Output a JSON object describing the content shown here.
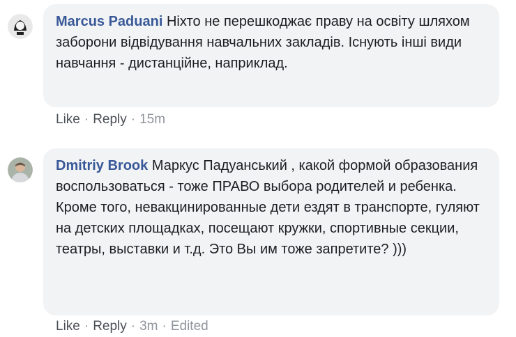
{
  "comments": [
    {
      "author": "Marcus Paduani",
      "text": "Ніхто не перешкоджає праву на освіту шляхом заборони відвідування навчальних закладів. Існують інші види навчання - дистанційне, наприклад.",
      "actions": {
        "like": "Like",
        "reply": "Reply",
        "time": "15m"
      },
      "avatar_icon": "person-avatar-icon"
    },
    {
      "author": "Dmitriy Brook",
      "text": "Маркус Падуанський , какой формой образования воспользоваться - тоже ПРАВО выбора родителей и ребенка. Кроме того, невакцинированные дети ездят в транспорте, гуляют на детских площадках, посещают кружки, спортивные секции, театры, выставки и т.д. Это Вы им тоже запретите? )))",
      "actions": {
        "like": "Like",
        "reply": "Reply",
        "time": "3m",
        "edited": "Edited"
      },
      "avatar_icon": "person-avatar-icon"
    }
  ],
  "separator": "·",
  "colors": {
    "author": "#385898",
    "bubble": "#f2f3f5",
    "text": "#1c1e21",
    "meta": "#90949c"
  }
}
